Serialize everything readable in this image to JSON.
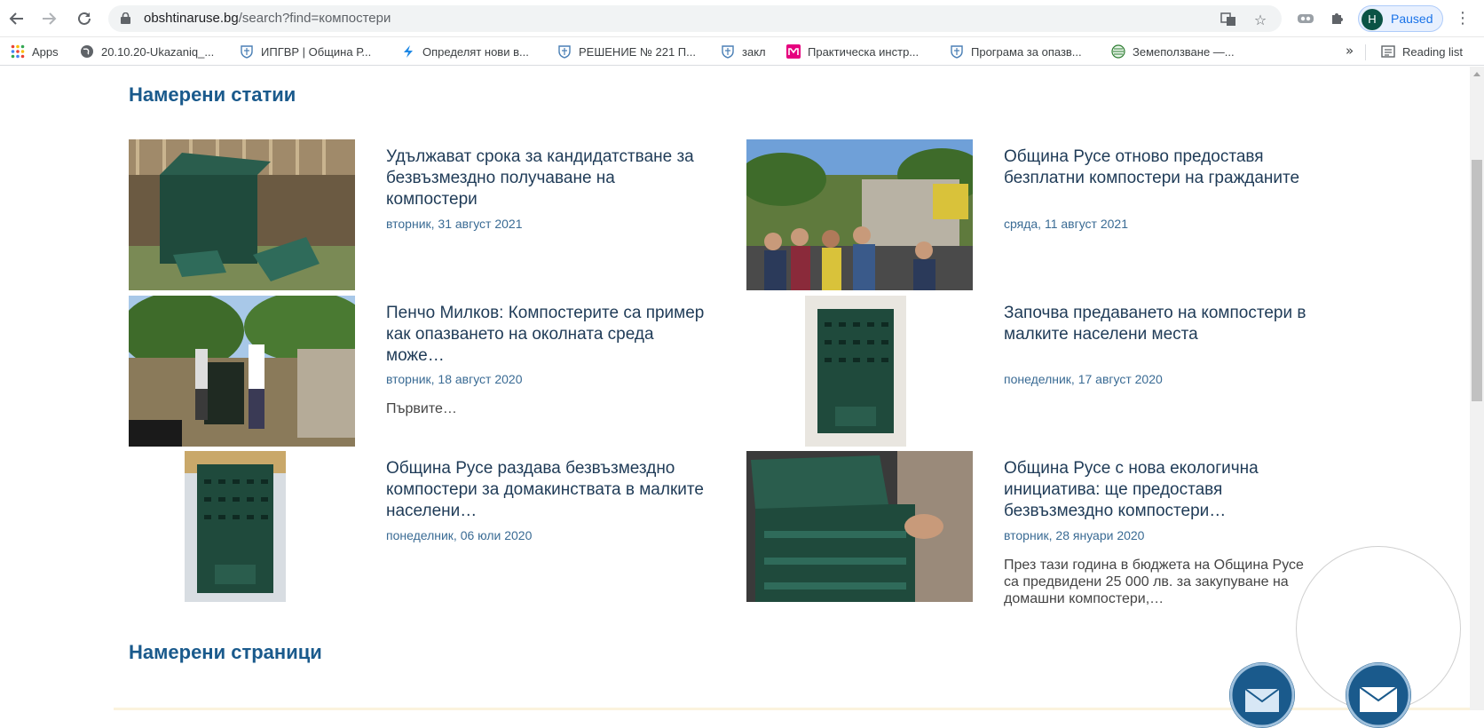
{
  "browser": {
    "url_host": "obshtinaruse.bg",
    "url_path": "/search?find=компостери",
    "profile_initial": "H",
    "profile_status": "Paused"
  },
  "bookmarks": [
    {
      "label": "Apps",
      "icon": "apps-grid-icon"
    },
    {
      "label": "20.10.20-Ukazaniq_...",
      "icon": "globe-icon"
    },
    {
      "label": "ИПГВР | Община Р...",
      "icon": "crest-icon"
    },
    {
      "label": "Определят нови в...",
      "icon": "lightning-icon"
    },
    {
      "label": "РЕШЕНИЕ № 221 П...",
      "icon": "crest-icon"
    },
    {
      "label": "закл",
      "icon": "crest-icon"
    },
    {
      "label": "Практическа инстр...",
      "icon": "m-logo-icon"
    },
    {
      "label": "Програма за опазв...",
      "icon": "crest-icon"
    },
    {
      "label": "Земеползване —...",
      "icon": "globe-green-icon"
    }
  ],
  "bookmarks_more": "»",
  "reading_list": "Reading list",
  "sections": {
    "articles_title": "Намерени статии",
    "pages_title": "Намерени страници"
  },
  "articles": [
    {
      "title": "Удължават срока за кандидатстване за безвъзмездно получаване на компостери",
      "date": "вторник, 31 август 2021",
      "excerpt": ""
    },
    {
      "title": "Община Русе отново предоставя безплатни компостери на гражданите",
      "date": "сряда, 11 август 2021",
      "excerpt": ""
    },
    {
      "title": "Пенчо Милков: Компостерите са пример как опазването на околната среда може…",
      "date": "вторник, 18 август 2020",
      "excerpt": "Първите…"
    },
    {
      "title": "Започва предаването на компостери в малките населени места",
      "date": "понеделник, 17 август 2020",
      "excerpt": ""
    },
    {
      "title": "Община Русе раздава безвъзмездно компостери за домакинствата в малките населени…",
      "date": "понеделник, 06 юли 2020",
      "excerpt": ""
    },
    {
      "title": "Община Русе с нова екологична инициатива: ще предоставя безвъзмездно компостери…",
      "date": "вторник, 28 януари 2020",
      "excerpt": "През тази година в бюджета на Община Русе са предвидени 25 000 лв. за закупуване на домашни компостери,…"
    }
  ],
  "colors": {
    "heading": "#1a5a8c",
    "title": "#1f3b57",
    "date": "#3a6b94",
    "composter": "#1f4a3c"
  }
}
